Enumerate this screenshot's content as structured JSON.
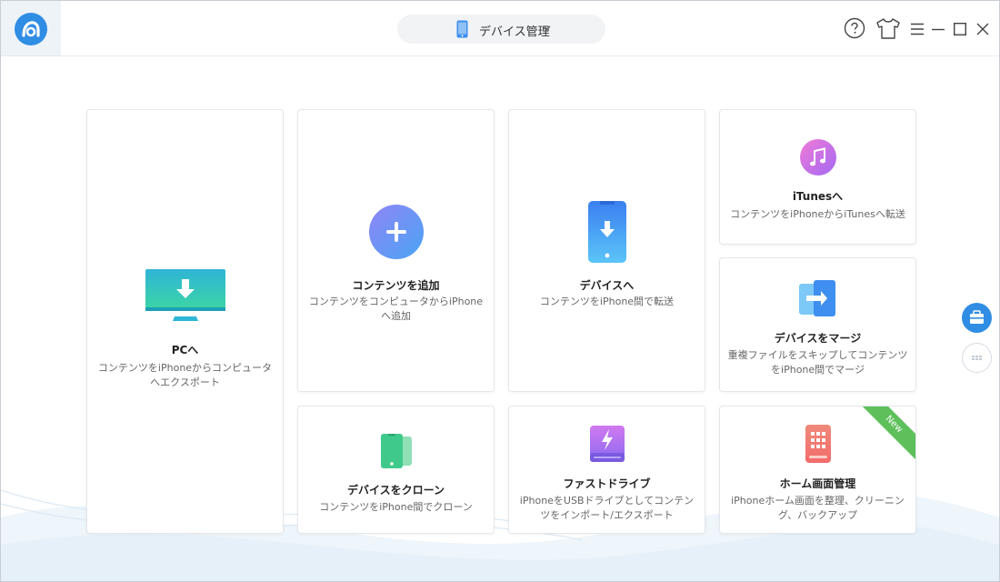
{
  "header": {
    "device_label": "デバイス管理"
  },
  "colors": {
    "accent": "#2f8de4",
    "new_badge": "#5dc05a"
  },
  "cards": [
    {
      "id": "to-pc",
      "title": "PCへ",
      "desc": "コンテンツをiPhoneからコンピュータへエクスポート",
      "icon": "monitor-download-icon"
    },
    {
      "id": "add-content",
      "title": "コンテンツを追加",
      "desc": "コンテンツをコンピュータからiPhoneへ追加",
      "icon": "plus-circle-icon"
    },
    {
      "id": "to-device",
      "title": "デバイスへ",
      "desc": "コンテンツをiPhone間で転送",
      "icon": "phone-download-icon"
    },
    {
      "id": "to-itunes",
      "title": "iTunesへ",
      "desc": "コンテンツをiPhoneからiTunesへ転送",
      "icon": "music-note-icon"
    },
    {
      "id": "merge-device",
      "title": "デバイスをマージ",
      "desc": "重複ファイルをスキップしてコンテンツをiPhone間でマージ",
      "icon": "phone-merge-icon"
    },
    {
      "id": "clone-device",
      "title": "デバイスをクローン",
      "desc": "コンテンツをiPhone間でクローン",
      "icon": "phone-clone-icon"
    },
    {
      "id": "fast-drive",
      "title": "ファストドライブ",
      "desc": "iPhoneをUSBドライブとしてコンテンツをインポート/エクスポート",
      "icon": "usb-drive-icon"
    },
    {
      "id": "home-screen",
      "title": "ホーム画面管理",
      "desc": "iPhoneホーム画面を整理、クリーニング、バックアップ",
      "icon": "home-screen-icon",
      "badge": "New"
    }
  ]
}
